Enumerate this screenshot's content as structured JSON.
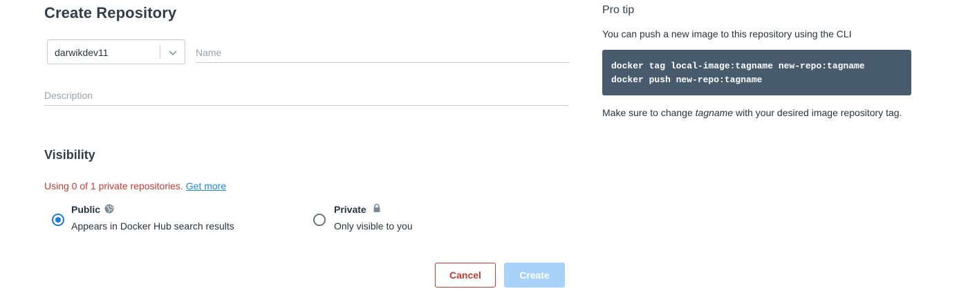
{
  "page": {
    "title": "Create Repository"
  },
  "form": {
    "namespace": "darwikdev11",
    "name_placeholder": "Name",
    "description_placeholder": "Description"
  },
  "visibility": {
    "title": "Visibility",
    "usage_text": "Using 0 of 1 private repositories.",
    "get_more_label": "Get more",
    "options": [
      {
        "label": "Public",
        "description": "Appears in Docker Hub search results",
        "icon": "globe-icon",
        "selected": true
      },
      {
        "label": "Private",
        "description": "Only visible to you",
        "icon": "lock-icon",
        "selected": false
      }
    ]
  },
  "actions": {
    "cancel_label": "Cancel",
    "create_label": "Create"
  },
  "pro_tip": {
    "title": "Pro tip",
    "intro": "You can push a new image to this repository using the CLI",
    "code_lines": [
      "docker tag local-image:tagname new-repo:tagname",
      "docker push new-repo:tagname"
    ],
    "note_before": "Make sure to change ",
    "note_emphasis": "tagname",
    "note_after": " with your desired image repository tag."
  },
  "colors": {
    "error_red": "#c23b30",
    "link_blue": "#1d8ad6",
    "radio_blue": "#1d7ae0",
    "create_disabled": "#a8d2f9",
    "code_bg": "#475b6c"
  }
}
